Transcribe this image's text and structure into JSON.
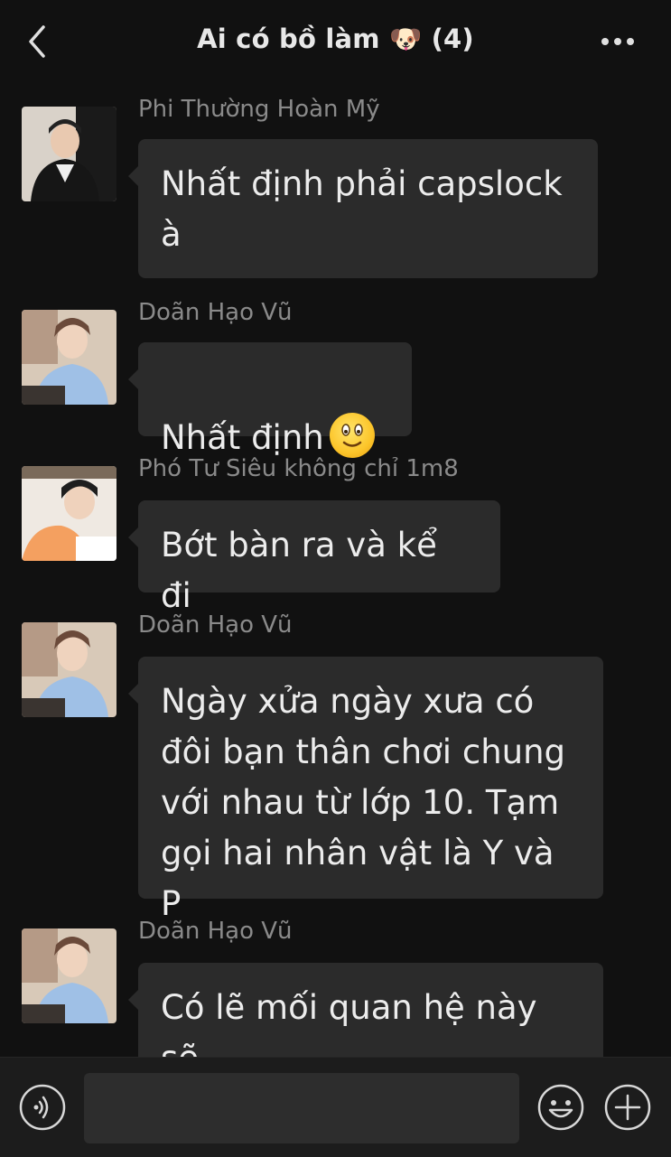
{
  "header": {
    "title": "Ai có bồ làm 🐶 (4)",
    "back_icon": "chevron-left-icon",
    "more_icon": "more-horizontal-icon"
  },
  "messages": [
    {
      "sender": "Phi Thường Hoàn Mỹ",
      "text": "Nhất định phải capslock\nà"
    },
    {
      "sender": "Doãn Hạo Vũ",
      "text": "Nhất định",
      "emoji": "smiling-face-emoji"
    },
    {
      "sender": "Phó Tư Siêu không chỉ 1m8",
      "text": "Bớt bàn ra và kể đi"
    },
    {
      "sender": "Doãn Hạo Vũ",
      "text": "Ngày xửa ngày xưa có\nđôi bạn thân chơi chung\nvới nhau từ lớp 10. Tạm\ngọi hai nhân vật là Y và P"
    },
    {
      "sender": "Doãn Hạo Vũ",
      "text": "Có lẽ mối quan hệ này sẽ\nrất tốt đẹp nếu Y không"
    }
  ],
  "input_bar": {
    "voice_icon": "voice-icon",
    "emoji_icon": "emoji-icon",
    "plus_icon": "plus-icon",
    "input_value": ""
  },
  "colors": {
    "background": "#111111",
    "bubble": "#2b2b2b",
    "sender_name": "#8a8a8a",
    "text": "#ececec"
  }
}
